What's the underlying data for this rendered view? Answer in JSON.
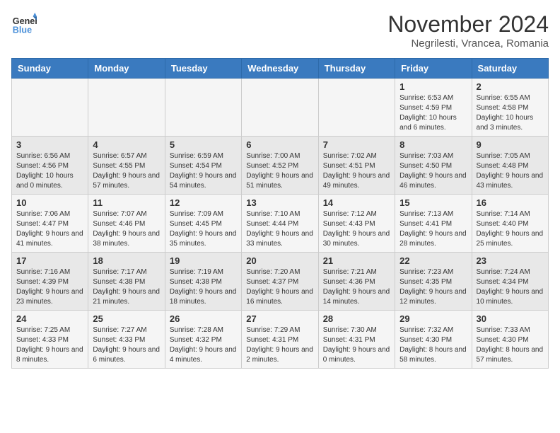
{
  "header": {
    "logo_line1": "General",
    "logo_line2": "Blue",
    "month_title": "November 2024",
    "location": "Negrilesti, Vrancea, Romania"
  },
  "days_of_week": [
    "Sunday",
    "Monday",
    "Tuesday",
    "Wednesday",
    "Thursday",
    "Friday",
    "Saturday"
  ],
  "weeks": [
    [
      {
        "day": "",
        "info": ""
      },
      {
        "day": "",
        "info": ""
      },
      {
        "day": "",
        "info": ""
      },
      {
        "day": "",
        "info": ""
      },
      {
        "day": "",
        "info": ""
      },
      {
        "day": "1",
        "info": "Sunrise: 6:53 AM\nSunset: 4:59 PM\nDaylight: 10 hours and 6 minutes."
      },
      {
        "day": "2",
        "info": "Sunrise: 6:55 AM\nSunset: 4:58 PM\nDaylight: 10 hours and 3 minutes."
      }
    ],
    [
      {
        "day": "3",
        "info": "Sunrise: 6:56 AM\nSunset: 4:56 PM\nDaylight: 10 hours and 0 minutes."
      },
      {
        "day": "4",
        "info": "Sunrise: 6:57 AM\nSunset: 4:55 PM\nDaylight: 9 hours and 57 minutes."
      },
      {
        "day": "5",
        "info": "Sunrise: 6:59 AM\nSunset: 4:54 PM\nDaylight: 9 hours and 54 minutes."
      },
      {
        "day": "6",
        "info": "Sunrise: 7:00 AM\nSunset: 4:52 PM\nDaylight: 9 hours and 51 minutes."
      },
      {
        "day": "7",
        "info": "Sunrise: 7:02 AM\nSunset: 4:51 PM\nDaylight: 9 hours and 49 minutes."
      },
      {
        "day": "8",
        "info": "Sunrise: 7:03 AM\nSunset: 4:50 PM\nDaylight: 9 hours and 46 minutes."
      },
      {
        "day": "9",
        "info": "Sunrise: 7:05 AM\nSunset: 4:48 PM\nDaylight: 9 hours and 43 minutes."
      }
    ],
    [
      {
        "day": "10",
        "info": "Sunrise: 7:06 AM\nSunset: 4:47 PM\nDaylight: 9 hours and 41 minutes."
      },
      {
        "day": "11",
        "info": "Sunrise: 7:07 AM\nSunset: 4:46 PM\nDaylight: 9 hours and 38 minutes."
      },
      {
        "day": "12",
        "info": "Sunrise: 7:09 AM\nSunset: 4:45 PM\nDaylight: 9 hours and 35 minutes."
      },
      {
        "day": "13",
        "info": "Sunrise: 7:10 AM\nSunset: 4:44 PM\nDaylight: 9 hours and 33 minutes."
      },
      {
        "day": "14",
        "info": "Sunrise: 7:12 AM\nSunset: 4:43 PM\nDaylight: 9 hours and 30 minutes."
      },
      {
        "day": "15",
        "info": "Sunrise: 7:13 AM\nSunset: 4:41 PM\nDaylight: 9 hours and 28 minutes."
      },
      {
        "day": "16",
        "info": "Sunrise: 7:14 AM\nSunset: 4:40 PM\nDaylight: 9 hours and 25 minutes."
      }
    ],
    [
      {
        "day": "17",
        "info": "Sunrise: 7:16 AM\nSunset: 4:39 PM\nDaylight: 9 hours and 23 minutes."
      },
      {
        "day": "18",
        "info": "Sunrise: 7:17 AM\nSunset: 4:38 PM\nDaylight: 9 hours and 21 minutes."
      },
      {
        "day": "19",
        "info": "Sunrise: 7:19 AM\nSunset: 4:38 PM\nDaylight: 9 hours and 18 minutes."
      },
      {
        "day": "20",
        "info": "Sunrise: 7:20 AM\nSunset: 4:37 PM\nDaylight: 9 hours and 16 minutes."
      },
      {
        "day": "21",
        "info": "Sunrise: 7:21 AM\nSunset: 4:36 PM\nDaylight: 9 hours and 14 minutes."
      },
      {
        "day": "22",
        "info": "Sunrise: 7:23 AM\nSunset: 4:35 PM\nDaylight: 9 hours and 12 minutes."
      },
      {
        "day": "23",
        "info": "Sunrise: 7:24 AM\nSunset: 4:34 PM\nDaylight: 9 hours and 10 minutes."
      }
    ],
    [
      {
        "day": "24",
        "info": "Sunrise: 7:25 AM\nSunset: 4:33 PM\nDaylight: 9 hours and 8 minutes."
      },
      {
        "day": "25",
        "info": "Sunrise: 7:27 AM\nSunset: 4:33 PM\nDaylight: 9 hours and 6 minutes."
      },
      {
        "day": "26",
        "info": "Sunrise: 7:28 AM\nSunset: 4:32 PM\nDaylight: 9 hours and 4 minutes."
      },
      {
        "day": "27",
        "info": "Sunrise: 7:29 AM\nSunset: 4:31 PM\nDaylight: 9 hours and 2 minutes."
      },
      {
        "day": "28",
        "info": "Sunrise: 7:30 AM\nSunset: 4:31 PM\nDaylight: 9 hours and 0 minutes."
      },
      {
        "day": "29",
        "info": "Sunrise: 7:32 AM\nSunset: 4:30 PM\nDaylight: 8 hours and 58 minutes."
      },
      {
        "day": "30",
        "info": "Sunrise: 7:33 AM\nSunset: 4:30 PM\nDaylight: 8 hours and 57 minutes."
      }
    ]
  ]
}
